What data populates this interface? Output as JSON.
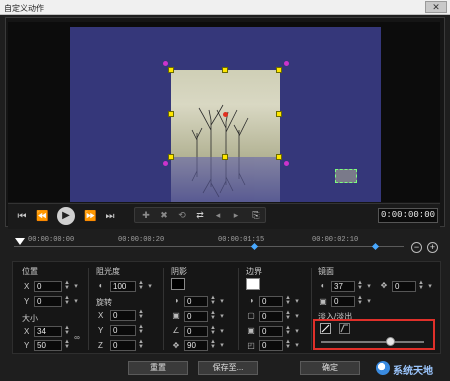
{
  "window": {
    "title": "自定义动作",
    "close_icon": "close-icon"
  },
  "transport": {
    "buttons": [
      "go-to-start-icon",
      "previous-frame-icon",
      "play-icon",
      "next-frame-icon",
      "go-to-end-icon"
    ],
    "timecode": "0:00:00:00"
  },
  "timeline": {
    "ticks": [
      "00:00:00:00",
      "00:00:00:20",
      "00:00:01:15",
      "00:00:02:10"
    ]
  },
  "position": {
    "heading": "位置",
    "x_label": "X",
    "x_value": "0",
    "y_label": "Y",
    "y_value": "0"
  },
  "size": {
    "heading": "大小",
    "x_label": "X",
    "x_value": "34",
    "y_label": "Y",
    "y_value": "50"
  },
  "opacity": {
    "heading": "阻光度",
    "value": "100"
  },
  "rotation": {
    "heading": "旋转",
    "x_label": "X",
    "x_value": "0",
    "y_label": "Y",
    "y_value": "0",
    "z_label": "Z",
    "z_value": "0"
  },
  "shadow": {
    "heading": "阴影",
    "color": "#000000",
    "values": [
      "0",
      "0",
      "0",
      "90"
    ]
  },
  "border": {
    "heading": "边界",
    "color": "#ffffff",
    "values": [
      "0",
      "0",
      "0",
      "0"
    ]
  },
  "mirror": {
    "heading": "镜面",
    "value1": "37",
    "value2": "0",
    "value3": "0"
  },
  "fade": {
    "heading": "淡入/淡出",
    "slider_fraction": 0.65
  },
  "footer": {
    "reset": "重置",
    "save_as": "保存至...",
    "ok": "确定"
  },
  "watermark": {
    "text": "系统天地"
  },
  "colors": {
    "canvas": "#35377a",
    "highlight": "#e0302a",
    "handles": "#ffe600",
    "keyframe": "#48a8ff"
  }
}
